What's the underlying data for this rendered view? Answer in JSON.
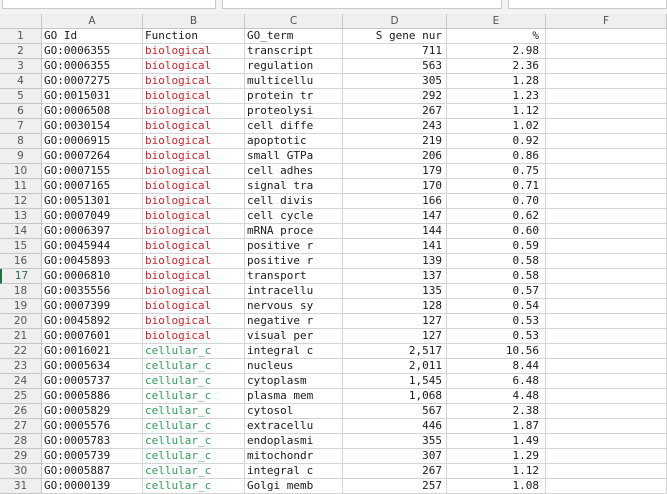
{
  "columns": [
    "A",
    "B",
    "C",
    "D",
    "E",
    "F"
  ],
  "selected_row": "17",
  "colors": {
    "biological": "#d2232a",
    "cellular": "#2f9e5a",
    "header_bg": "#efefef",
    "grid": "#d4d4d4"
  },
  "rows": [
    {
      "n": "1",
      "a": "GO Id",
      "b": "Function",
      "c": "GO_term",
      "d": "S gene nur",
      "e": "%",
      "k": ""
    },
    {
      "n": "2",
      "a": "GO:0006355",
      "b": "biological",
      "c": "transcript",
      "d": "711",
      "e": "2.98",
      "k": "bio"
    },
    {
      "n": "3",
      "a": "GO:0006355",
      "b": "biological",
      "c": "regulation",
      "d": "563",
      "e": "2.36",
      "k": "bio"
    },
    {
      "n": "4",
      "a": "GO:0007275",
      "b": "biological",
      "c": "multicellu",
      "d": "305",
      "e": "1.28",
      "k": "bio"
    },
    {
      "n": "5",
      "a": "GO:0015031",
      "b": "biological",
      "c": "protein tr",
      "d": "292",
      "e": "1.23",
      "k": "bio"
    },
    {
      "n": "6",
      "a": "GO:0006508",
      "b": "biological",
      "c": "proteolysi",
      "d": "267",
      "e": "1.12",
      "k": "bio"
    },
    {
      "n": "7",
      "a": "GO:0030154",
      "b": "biological",
      "c": "cell diffe",
      "d": "243",
      "e": "1.02",
      "k": "bio"
    },
    {
      "n": "8",
      "a": "GO:0006915",
      "b": "biological",
      "c": "apoptotic",
      "d": "219",
      "e": "0.92",
      "k": "bio"
    },
    {
      "n": "9",
      "a": "GO:0007264",
      "b": "biological",
      "c": "small GTPa",
      "d": "206",
      "e": "0.86",
      "k": "bio"
    },
    {
      "n": "10",
      "a": "GO:0007155",
      "b": "biological",
      "c": "cell adhes",
      "d": "179",
      "e": "0.75",
      "k": "bio"
    },
    {
      "n": "11",
      "a": "GO:0007165",
      "b": "biological",
      "c": "signal tra",
      "d": "170",
      "e": "0.71",
      "k": "bio"
    },
    {
      "n": "12",
      "a": "GO:0051301",
      "b": "biological",
      "c": "cell divis",
      "d": "166",
      "e": "0.70",
      "k": "bio"
    },
    {
      "n": "13",
      "a": "GO:0007049",
      "b": "biological",
      "c": "cell cycle",
      "d": "147",
      "e": "0.62",
      "k": "bio"
    },
    {
      "n": "14",
      "a": "GO:0006397",
      "b": "biological",
      "c": "mRNA proce",
      "d": "144",
      "e": "0.60",
      "k": "bio"
    },
    {
      "n": "15",
      "a": "GO:0045944",
      "b": "biological",
      "c": "positive r",
      "d": "141",
      "e": "0.59",
      "k": "bio"
    },
    {
      "n": "16",
      "a": "GO:0045893",
      "b": "biological",
      "c": "positive r",
      "d": "139",
      "e": "0.58",
      "k": "bio"
    },
    {
      "n": "17",
      "a": "GO:0006810",
      "b": "biological",
      "c": "transport",
      "d": "137",
      "e": "0.58",
      "k": "bio"
    },
    {
      "n": "18",
      "a": "GO:0035556",
      "b": "biological",
      "c": "intracellu",
      "d": "135",
      "e": "0.57",
      "k": "bio"
    },
    {
      "n": "19",
      "a": "GO:0007399",
      "b": "biological",
      "c": "nervous sy",
      "d": "128",
      "e": "0.54",
      "k": "bio"
    },
    {
      "n": "20",
      "a": "GO:0045892",
      "b": "biological",
      "c": "negative r",
      "d": "127",
      "e": "0.53",
      "k": "bio"
    },
    {
      "n": "21",
      "a": "GO:0007601",
      "b": "biological",
      "c": "visual per",
      "d": "127",
      "e": "0.53",
      "k": "bio"
    },
    {
      "n": "22",
      "a": "GO:0016021",
      "b": "cellular_c",
      "c": "integral c",
      "d": "2,517",
      "e": "10.56",
      "k": "cel"
    },
    {
      "n": "23",
      "a": "GO:0005634",
      "b": "cellular_c",
      "c": "nucleus",
      "d": "2,011",
      "e": "8.44",
      "k": "cel"
    },
    {
      "n": "24",
      "a": "GO:0005737",
      "b": "cellular_c",
      "c": "cytoplasm",
      "d": "1,545",
      "e": "6.48",
      "k": "cel"
    },
    {
      "n": "25",
      "a": "GO:0005886",
      "b": "cellular_c",
      "c": "plasma mem",
      "d": "1,068",
      "e": "4.48",
      "k": "cel"
    },
    {
      "n": "26",
      "a": "GO:0005829",
      "b": "cellular_c",
      "c": "cytosol",
      "d": "567",
      "e": "2.38",
      "k": "cel"
    },
    {
      "n": "27",
      "a": "GO:0005576",
      "b": "cellular_c",
      "c": "extracellu",
      "d": "446",
      "e": "1.87",
      "k": "cel"
    },
    {
      "n": "28",
      "a": "GO:0005783",
      "b": "cellular_c",
      "c": "endoplasmi",
      "d": "355",
      "e": "1.49",
      "k": "cel"
    },
    {
      "n": "29",
      "a": "GO:0005739",
      "b": "cellular_c",
      "c": "mitochondr",
      "d": "307",
      "e": "1.29",
      "k": "cel"
    },
    {
      "n": "30",
      "a": "GO:0005887",
      "b": "cellular_c",
      "c": "integral c",
      "d": "267",
      "e": "1.12",
      "k": "cel"
    },
    {
      "n": "31",
      "a": "GO:0000139",
      "b": "cellular_c",
      "c": "Golgi memb",
      "d": "257",
      "e": "1.08",
      "k": "cel"
    }
  ]
}
